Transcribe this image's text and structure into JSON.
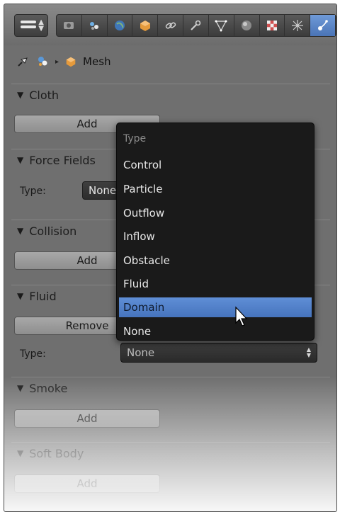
{
  "breadcrumb": {
    "object_label": "Mesh"
  },
  "panels": {
    "cloth": {
      "title": "Cloth",
      "add_label": "Add"
    },
    "force_fields": {
      "title": "Force Fields",
      "type_label": "Type:",
      "type_value": "None"
    },
    "collision": {
      "title": "Collision",
      "add_label": "Add"
    },
    "fluid": {
      "title": "Fluid",
      "remove_label": "Remove",
      "type_label": "Type:",
      "type_value": "None"
    },
    "smoke": {
      "title": "Smoke",
      "add_label": "Add"
    },
    "soft_body": {
      "title": "Soft Body",
      "add_label": "Add"
    }
  },
  "fluid_type_menu": {
    "title": "Type",
    "options": [
      "Control",
      "Particle",
      "Outflow",
      "Inflow",
      "Obstacle",
      "Fluid",
      "Domain",
      "None"
    ],
    "highlighted": "Domain"
  },
  "colors": {
    "highlight": "#4f7fcb",
    "menu_bg": "#1a1a1a",
    "panel_bg": "#6f6f6f"
  }
}
